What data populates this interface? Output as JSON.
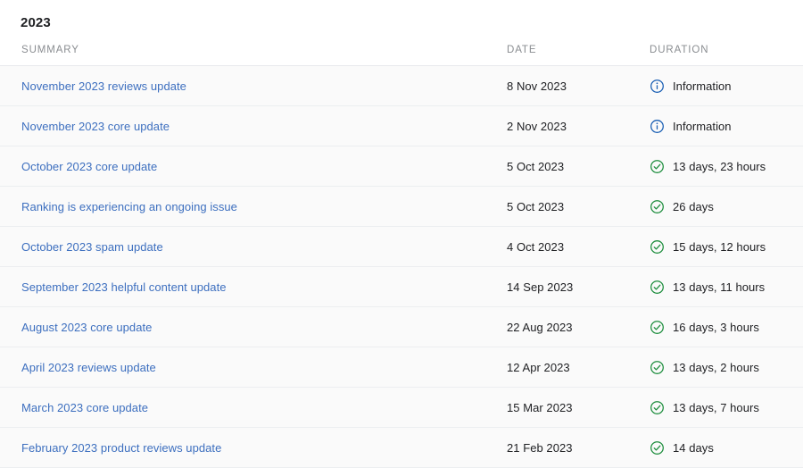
{
  "page": {
    "year_heading": "2023"
  },
  "table": {
    "columns": {
      "summary": "SUMMARY",
      "date": "DATE",
      "duration": "DURATION"
    },
    "colors": {
      "link": "#3d6fbf",
      "info_icon": "#1a5fb4",
      "ok_icon": "#1e8e3e",
      "row_background": "#fafafa",
      "row_divider": "#eceef0",
      "header_text": "#8a8d91",
      "body_text": "#202124"
    },
    "rows": [
      {
        "summary": "November 2023 reviews update",
        "date": "8 Nov 2023",
        "duration": "Information",
        "status_icon": "info-circle-icon"
      },
      {
        "summary": "November 2023 core update",
        "date": "2 Nov 2023",
        "duration": "Information",
        "status_icon": "info-circle-icon"
      },
      {
        "summary": "October 2023 core update",
        "date": "5 Oct 2023",
        "duration": "13 days, 23 hours",
        "status_icon": "check-circle-icon"
      },
      {
        "summary": "Ranking is experiencing an ongoing issue",
        "date": "5 Oct 2023",
        "duration": "26 days",
        "status_icon": "check-circle-icon"
      },
      {
        "summary": "October 2023 spam update",
        "date": "4 Oct 2023",
        "duration": "15 days, 12 hours",
        "status_icon": "check-circle-icon"
      },
      {
        "summary": "September 2023 helpful content update",
        "date": "14 Sep 2023",
        "duration": "13 days, 11 hours",
        "status_icon": "check-circle-icon"
      },
      {
        "summary": "August 2023 core update",
        "date": "22 Aug 2023",
        "duration": "16 days, 3 hours",
        "status_icon": "check-circle-icon"
      },
      {
        "summary": "April 2023 reviews update",
        "date": "12 Apr 2023",
        "duration": "13 days, 2 hours",
        "status_icon": "check-circle-icon"
      },
      {
        "summary": "March 2023 core update",
        "date": "15 Mar 2023",
        "duration": "13 days, 7 hours",
        "status_icon": "check-circle-icon"
      },
      {
        "summary": "February 2023 product reviews update",
        "date": "21 Feb 2023",
        "duration": "14 days",
        "status_icon": "check-circle-icon"
      }
    ]
  }
}
